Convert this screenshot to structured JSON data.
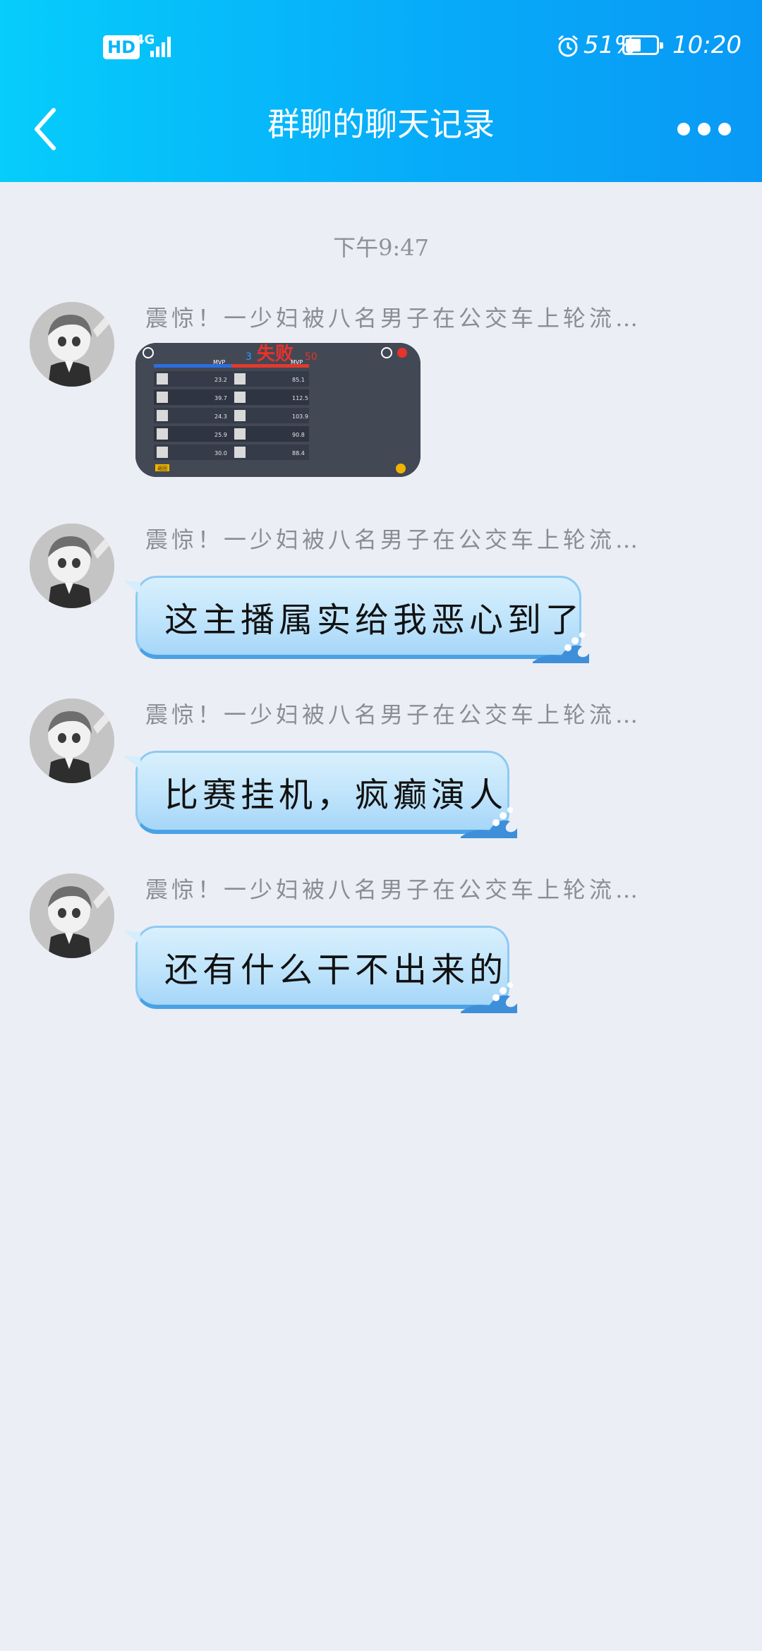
{
  "status_bar": {
    "hd": "HD",
    "network": "4G",
    "battery_percent": "51%",
    "battery_level": 0.51,
    "time": "10:20",
    "icons": [
      "signal-icon",
      "alarm-icon",
      "battery-icon"
    ]
  },
  "header": {
    "title": "群聊的聊天记录",
    "back_icon": "chevron-left-icon",
    "more_icon": "more-dots-icon"
  },
  "time_divider": "下午9:47",
  "messages": [
    {
      "sender": "震惊！一少妇被八名男子在公交车上轮流…",
      "type": "image"
    },
    {
      "sender": "震惊！一少妇被八名男子在公交车上轮流…",
      "type": "text",
      "text": "这主播属实给我恶心到了"
    },
    {
      "sender": "震惊！一少妇被八名男子在公交车上轮流…",
      "type": "text",
      "text": "比赛挂机，疯癫演人"
    },
    {
      "sender": "震惊！一少妇被八名男子在公交车上轮流…",
      "type": "text",
      "text": "还有什么干不出来的"
    }
  ],
  "game_screenshot": {
    "result": "失败",
    "score_left": "3",
    "score_right": "50",
    "column_mvp": "MVP",
    "left_mvp_values": [
      "23.2",
      "39.7",
      "24.3",
      "25.9",
      "30.0"
    ],
    "right_mvp_values": [
      "85.1",
      "112.5",
      "103.9",
      "90.8",
      "88.4"
    ],
    "button_label": "返回"
  },
  "colors": {
    "header_start": "#06cdfb",
    "header_end": "#0999f5",
    "page_bg": "#eceef5",
    "bubble": "#bfe4fb",
    "team_blue": "#2a6fe0",
    "team_red": "#e03a2e"
  }
}
